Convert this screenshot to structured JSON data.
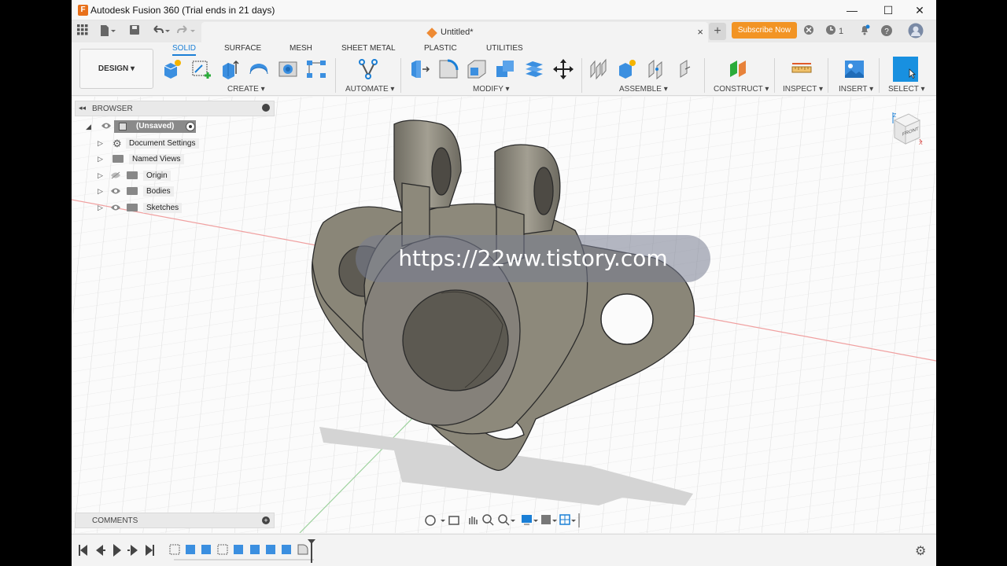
{
  "window": {
    "title": "Autodesk Fusion 360 (Trial ends in 21 days)",
    "app_icon_letter": "F",
    "minimize": "—",
    "maximize": "☐",
    "close": "✕"
  },
  "tabbar": {
    "doc_title": "Untitled*",
    "close": "×",
    "new_tab": "+",
    "subscribe_label": "Subscribe Now",
    "job_count": "1"
  },
  "toolbar": {
    "workspace": "DESIGN ▾",
    "tabs": [
      "SOLID",
      "SURFACE",
      "MESH",
      "SHEET METAL",
      "PLASTIC",
      "UTILITIES"
    ],
    "groups": [
      "CREATE ▾",
      "AUTOMATE ▾",
      "MODIFY ▾",
      "ASSEMBLE ▾",
      "CONSTRUCT ▾",
      "INSPECT ▾",
      "INSERT ▾",
      "SELECT ▾"
    ]
  },
  "browser": {
    "title": "BROWSER",
    "root": "(Unsaved)",
    "items": [
      "Document Settings",
      "Named Views",
      "Origin",
      "Bodies",
      "Sketches"
    ]
  },
  "comments": {
    "title": "COMMENTS"
  },
  "viewcube": {
    "face": "FRONT",
    "axis_z": "Z",
    "axis_x": "X"
  },
  "watermark": "https://22ww.tistory.com",
  "colors": {
    "accent": "#1a7fd6",
    "subscribe": "#f29424",
    "part": "#8a8678"
  }
}
